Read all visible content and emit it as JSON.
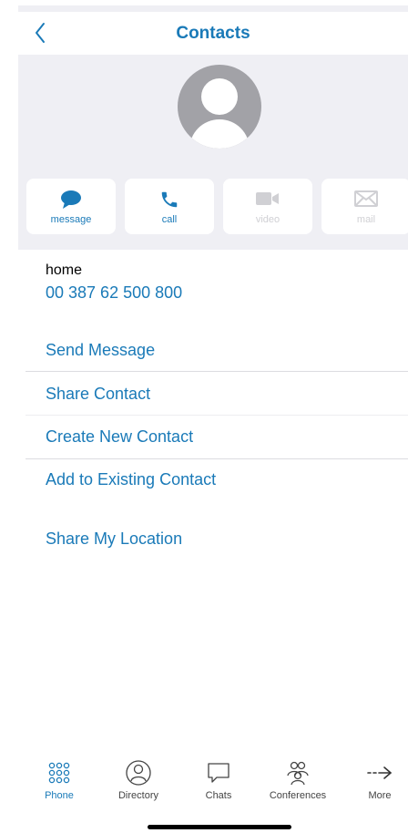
{
  "nav": {
    "title": "Contacts"
  },
  "actions": [
    {
      "label": "message",
      "icon": "message-bubble-icon",
      "enabled": true
    },
    {
      "label": "call",
      "icon": "phone-icon",
      "enabled": true
    },
    {
      "label": "video",
      "icon": "video-camera-icon",
      "enabled": false
    },
    {
      "label": "mail",
      "icon": "envelope-icon",
      "enabled": false
    }
  ],
  "contact": {
    "phone_label": "home",
    "phone_number": "00 387 62 500 800"
  },
  "menu": {
    "send_message": "Send Message",
    "share_contact": "Share Contact",
    "create_new_contact": "Create New Contact",
    "add_to_existing": "Add to Existing Contact",
    "share_location": "Share My Location"
  },
  "tabs": [
    {
      "label": "Phone",
      "icon": "keypad-icon",
      "active": true
    },
    {
      "label": "Directory",
      "icon": "directory-icon",
      "active": false
    },
    {
      "label": "Chats",
      "icon": "chat-bubble-icon",
      "active": false
    },
    {
      "label": "Conferences",
      "icon": "conference-group-icon",
      "active": false
    },
    {
      "label": "More",
      "icon": "more-arrow-icon",
      "active": false
    }
  ],
  "colors": {
    "accent": "#1a7ab8",
    "header_bg": "#efeff4",
    "disabled": "#d0d0d4",
    "avatar": "#a2a2a7"
  }
}
